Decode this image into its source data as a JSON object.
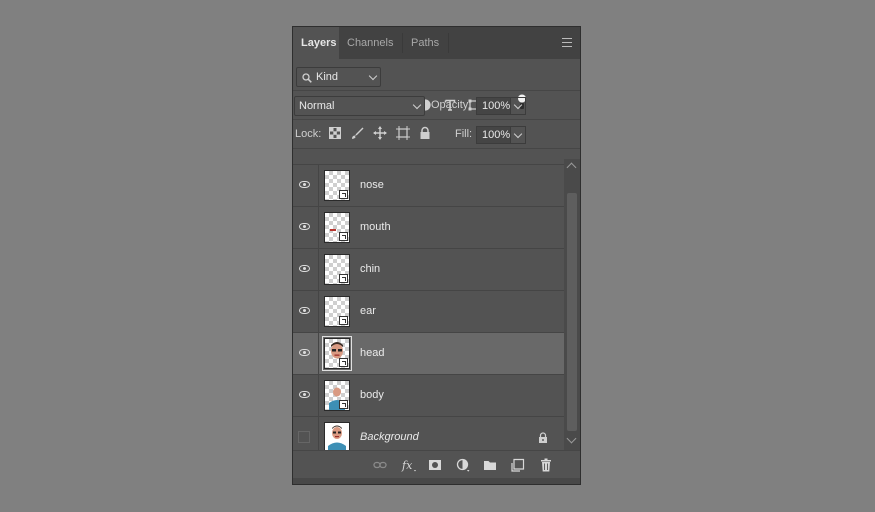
{
  "tabs": [
    {
      "label": "Layers",
      "active": true
    },
    {
      "label": "Channels",
      "active": false
    },
    {
      "label": "Paths",
      "active": false
    }
  ],
  "filter": {
    "kind_label": "Kind"
  },
  "blend": {
    "mode": "Normal",
    "opacity_label": "Opacity:",
    "opacity_value": "100%"
  },
  "lock": {
    "label": "Lock:",
    "fill_label": "Fill:",
    "fill_value": "100%"
  },
  "layers": [
    {
      "name": "nose",
      "visible": true,
      "selected": false
    },
    {
      "name": "mouth",
      "visible": true,
      "selected": false
    },
    {
      "name": "chin",
      "visible": true,
      "selected": false
    },
    {
      "name": "ear",
      "visible": true,
      "selected": false
    },
    {
      "name": "head",
      "visible": true,
      "selected": true
    },
    {
      "name": "body",
      "visible": true,
      "selected": false
    },
    {
      "name": "Background",
      "visible": false,
      "selected": false,
      "locked": true
    }
  ],
  "icons": {
    "filter": [
      "search-icon",
      "image-filter-icon",
      "adjustment-filter-icon",
      "type-filter-icon",
      "shape-filter-icon",
      "smart-object-filter-icon",
      "filter-toggle-icon"
    ],
    "lock": [
      "lock-transparent-pixels-icon",
      "lock-image-pixels-icon",
      "lock-position-icon",
      "lock-artboard-icon",
      "lock-all-icon"
    ],
    "footer": [
      "link-layers-icon",
      "fx-icon",
      "add-mask-icon",
      "new-adjustment-icon",
      "new-group-icon",
      "new-layer-icon",
      "delete-layer-icon"
    ]
  },
  "colors": {
    "panel": "#535353",
    "selected_row": "#696969",
    "tabbar": "#424242",
    "canvas": "#808080"
  }
}
